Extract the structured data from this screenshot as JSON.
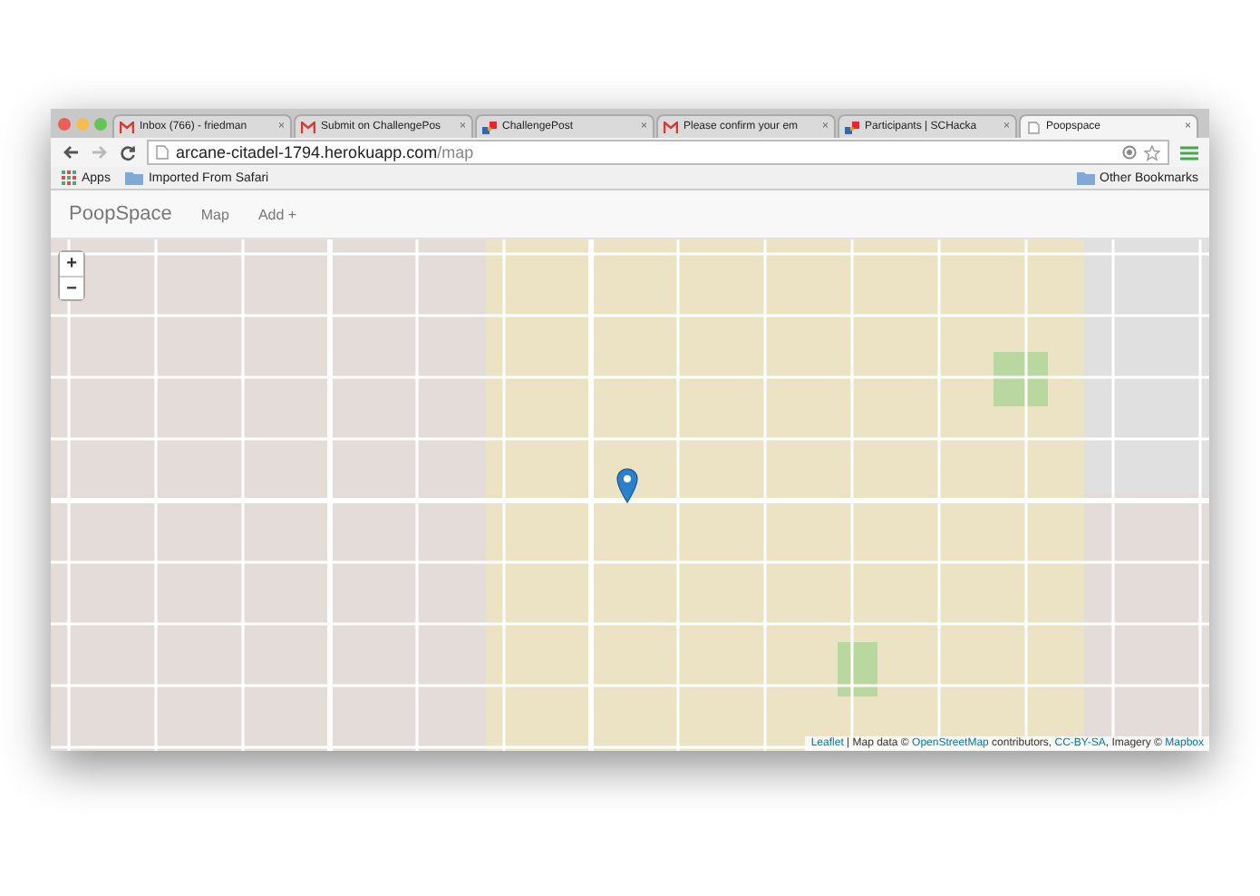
{
  "tabs": [
    {
      "title": "Inbox (766) - friedman",
      "kind": "gmail",
      "close": "×",
      "selected": false
    },
    {
      "title": "Submit on ChallengePos",
      "kind": "gmail",
      "close": "×",
      "selected": false
    },
    {
      "title": "ChallengePost",
      "kind": "cp",
      "close": "×",
      "selected": false
    },
    {
      "title": "Please confirm your em",
      "kind": "gmail",
      "close": "×",
      "selected": false
    },
    {
      "title": "Participants | SCHacka",
      "kind": "cp",
      "close": "×",
      "selected": false
    },
    {
      "title": "Poopspace",
      "kind": "page",
      "close": "×",
      "selected": true
    }
  ],
  "address_bar": {
    "host": "arcane-citadel-1794.herokuapp.com",
    "path": "/map"
  },
  "bookmarks": [
    {
      "label": "Apps",
      "kind": "apps"
    },
    {
      "label": "Imported From Safari",
      "kind": "folder"
    }
  ],
  "other_bookmarks": "Other Bookmarks",
  "navbar": {
    "brand": "PoopSpace",
    "links": [
      "Map",
      "Add +"
    ]
  },
  "map": {
    "zoom_in": "+",
    "zoom_out": "−",
    "attribution": [
      {
        "text": "Leaflet",
        "kind": "link"
      },
      {
        "text": " | Map data © ",
        "kind": "text"
      },
      {
        "text": "OpenStreetMap",
        "kind": "link"
      },
      {
        "text": " contributors, ",
        "kind": "text"
      },
      {
        "text": "CC-BY-SA",
        "kind": "link"
      },
      {
        "text": ", Imagery © ",
        "kind": "text"
      },
      {
        "text": "Mapbox",
        "kind": "link"
      }
    ]
  }
}
